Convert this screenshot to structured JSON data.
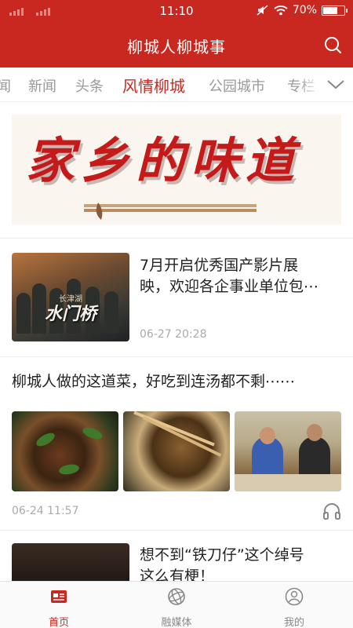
{
  "status_bar": {
    "time": "11:10",
    "battery": "70%",
    "battery_level": 0.7
  },
  "header": {
    "title": "柳城人柳城事",
    "search_icon": "search-icon",
    "bar_color": "#c8281f"
  },
  "tabs": {
    "items": [
      "闻",
      "新闻",
      "头条",
      "风情柳城",
      "公园城市",
      "专栏"
    ],
    "active_index": 3,
    "more_icon": "chevron-down-icon",
    "accent_color": "#c8281f"
  },
  "banner": {
    "text": "家乡的味道"
  },
  "articles": [
    {
      "title_line1": "7月开启优秀国产影片展",
      "title_line2": "映，欢迎各企事业单位包⋯",
      "poster_title": "水门桥",
      "poster_subtitle": "长津湖",
      "time": "06-27 20:28"
    },
    {
      "title": "柳城人做的这道菜，好吃到连汤都不剩⋯⋯",
      "time": "06-24 11:57",
      "audio_icon": "headphones-icon"
    },
    {
      "title_line1": "想不到“铁刀仔”这个绰号",
      "title_line2": "这么有梗！"
    }
  ],
  "bottom_nav": [
    {
      "label": "首页",
      "icon": "home-news-icon",
      "active": true
    },
    {
      "label": "融媒体",
      "icon": "globe-icon",
      "active": false
    },
    {
      "label": "我的",
      "icon": "user-icon",
      "active": false
    }
  ]
}
